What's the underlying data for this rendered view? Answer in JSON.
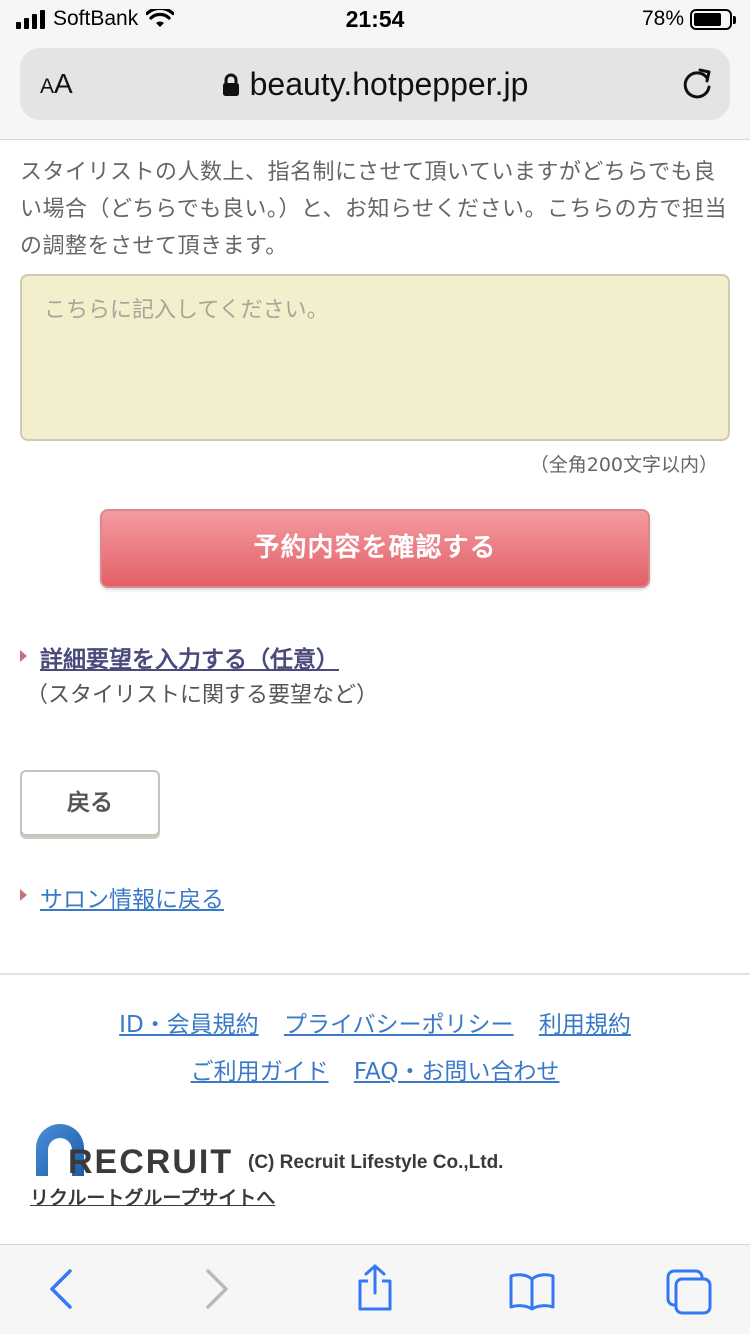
{
  "status_bar": {
    "carrier": "SoftBank",
    "time": "21:54",
    "battery": "78%",
    "battery_level": 0.78
  },
  "address_bar": {
    "text_size_label": "AA",
    "url": "beauty.hotpepper.jp"
  },
  "form": {
    "intro_text": "スタイリストの人数上、指名制にさせて頂いていますがどちらでも良い場合（どちらでも良い。）と、お知らせください。こちらの方で担当の調整をさせて頂きます。",
    "textarea_placeholder": "こちらに記入してください。",
    "textarea_value": "",
    "char_limit": "（全角200文字以内）",
    "confirm_label": "予約内容を確認する"
  },
  "details": {
    "link_label": "詳細要望を入力する（任意）",
    "sub_label": "（スタイリストに関する要望など）"
  },
  "back_label": "戻る",
  "salon_link_label": "サロン情報に戻る",
  "footer": {
    "links_row1": [
      "ID・会員規約",
      "プライバシーポリシー",
      "利用規約"
    ],
    "links_row2": [
      "ご利用ガイド",
      "FAQ・お問い合わせ"
    ],
    "logo_text": "RECRUIT",
    "copyright": "(C) Recruit Lifestyle Co.,Ltd.",
    "group_link": "リクルートグループサイトへ"
  },
  "toolbar": {
    "icons": [
      "back-icon",
      "forward-icon",
      "share-icon",
      "bookmarks-icon",
      "tabs-icon"
    ]
  },
  "colors": {
    "accent_link": "#3a79c8",
    "confirm_button": "#e35f68",
    "textarea_bg": "#f3efcd",
    "toolbar_icon": "#3478f6"
  }
}
